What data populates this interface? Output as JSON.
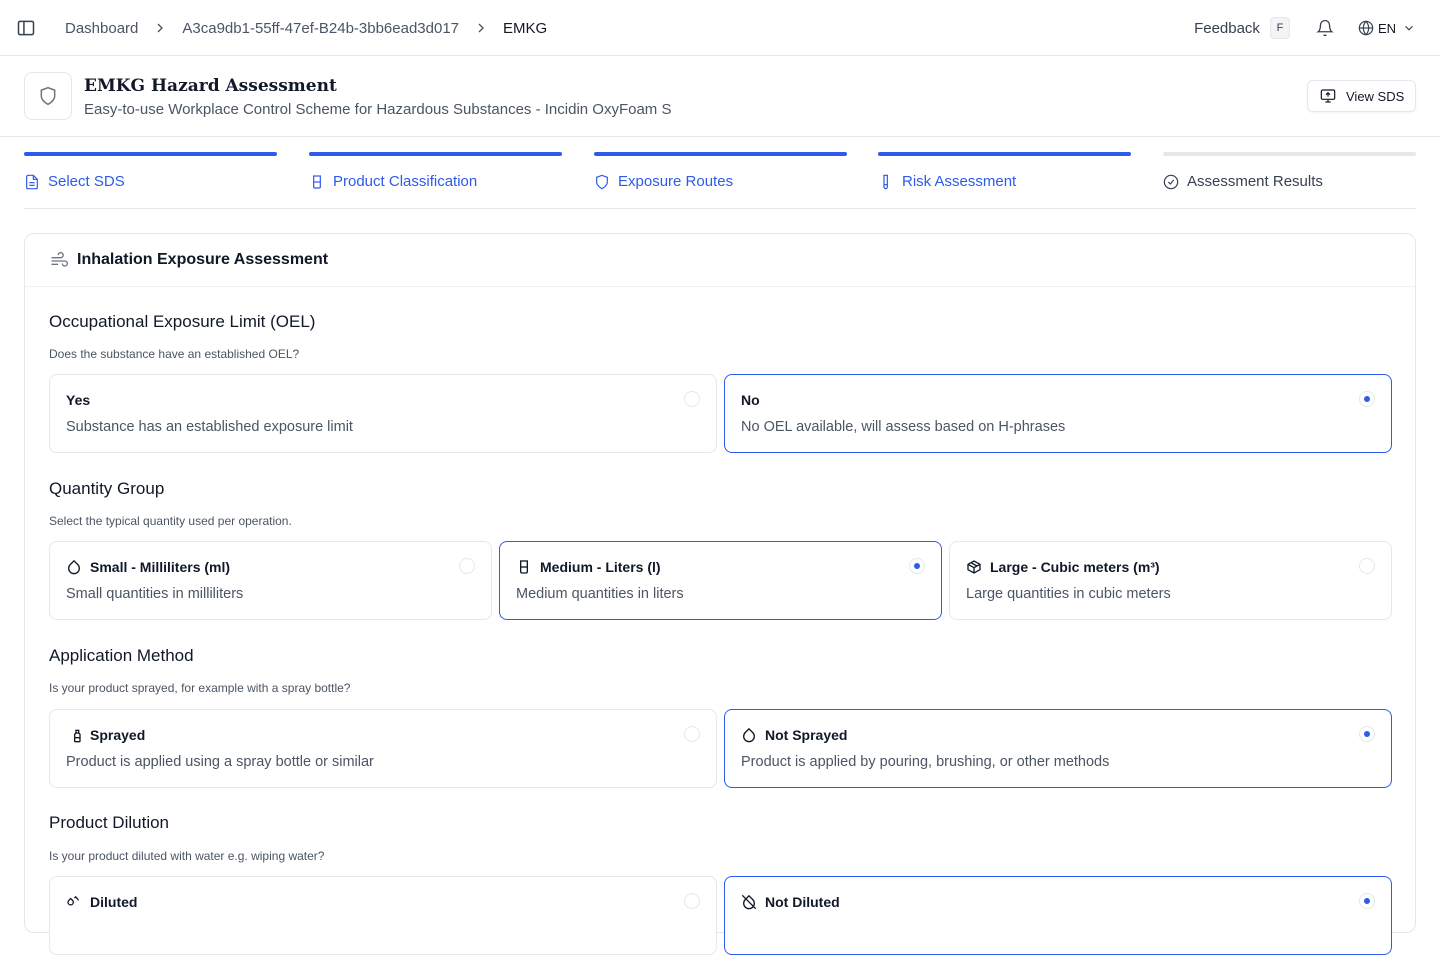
{
  "breadcrumb": {
    "items": [
      "Dashboard",
      "A3ca9db1-55ff-47ef-B24b-3bb6ead3d017",
      "EMKG"
    ]
  },
  "topbar": {
    "feedback_label": "Feedback",
    "feedback_shortcut": "F",
    "language": "EN"
  },
  "header": {
    "title": "EMKG Hazard Assessment",
    "subtitle": "Easy-to-use Workplace Control Scheme for Hazardous Substances - Incidin OxyFoam S",
    "view_sds_label": "View SDS"
  },
  "steps": [
    {
      "label": "Select SDS",
      "icon": "file-text-icon",
      "state": "complete"
    },
    {
      "label": "Product Classification",
      "icon": "beaker-icon",
      "state": "complete"
    },
    {
      "label": "Exposure Routes",
      "icon": "shield-icon",
      "state": "complete"
    },
    {
      "label": "Risk Assessment",
      "icon": "test-tube-icon",
      "state": "active"
    },
    {
      "label": "Assessment Results",
      "icon": "check-circle-icon",
      "state": "pending"
    }
  ],
  "card": {
    "title": "Inhalation Exposure Assessment",
    "icon": "wind-icon",
    "sections": {
      "oel": {
        "title": "Occupational Exposure Limit (OEL)",
        "description": "Does the substance have an established OEL?",
        "options": [
          {
            "title": "Yes",
            "description": "Substance has an established exposure limit",
            "selected": false
          },
          {
            "title": "No",
            "description": "No OEL available, will assess based on H-phrases",
            "selected": true
          }
        ]
      },
      "quantity": {
        "title": "Quantity Group",
        "description": "Select the typical quantity used per operation.",
        "options": [
          {
            "title": "Small - Milliliters (ml)",
            "description": "Small quantities in milliliters",
            "icon": "droplet-icon",
            "selected": false
          },
          {
            "title": "Medium - Liters (l)",
            "description": "Medium quantities in liters",
            "icon": "beaker-icon",
            "selected": true
          },
          {
            "title": "Large - Cubic meters (m³)",
            "description": "Large quantities in cubic meters",
            "icon": "package-icon",
            "selected": false
          }
        ]
      },
      "application": {
        "title": "Application Method",
        "description": "Is your product sprayed, for example with a spray bottle?",
        "options": [
          {
            "title": "Sprayed",
            "description": "Product is applied using a spray bottle or similar",
            "icon": "spray-can-icon",
            "selected": false
          },
          {
            "title": "Not Sprayed",
            "description": "Product is applied by pouring, brushing, or other methods",
            "icon": "droplet-icon",
            "selected": true
          }
        ]
      },
      "dilution": {
        "title": "Product Dilution",
        "description": "Is your product diluted with water e.g. wiping water?",
        "options": [
          {
            "title": "Diluted",
            "icon": "droplets-icon",
            "selected": false
          },
          {
            "title": "Not Diluted",
            "icon": "droplet-off-icon",
            "selected": true
          }
        ]
      }
    }
  },
  "colors": {
    "accent": "#2e5bea",
    "border": "#e5e7eb",
    "muted_text": "#4b5563"
  }
}
